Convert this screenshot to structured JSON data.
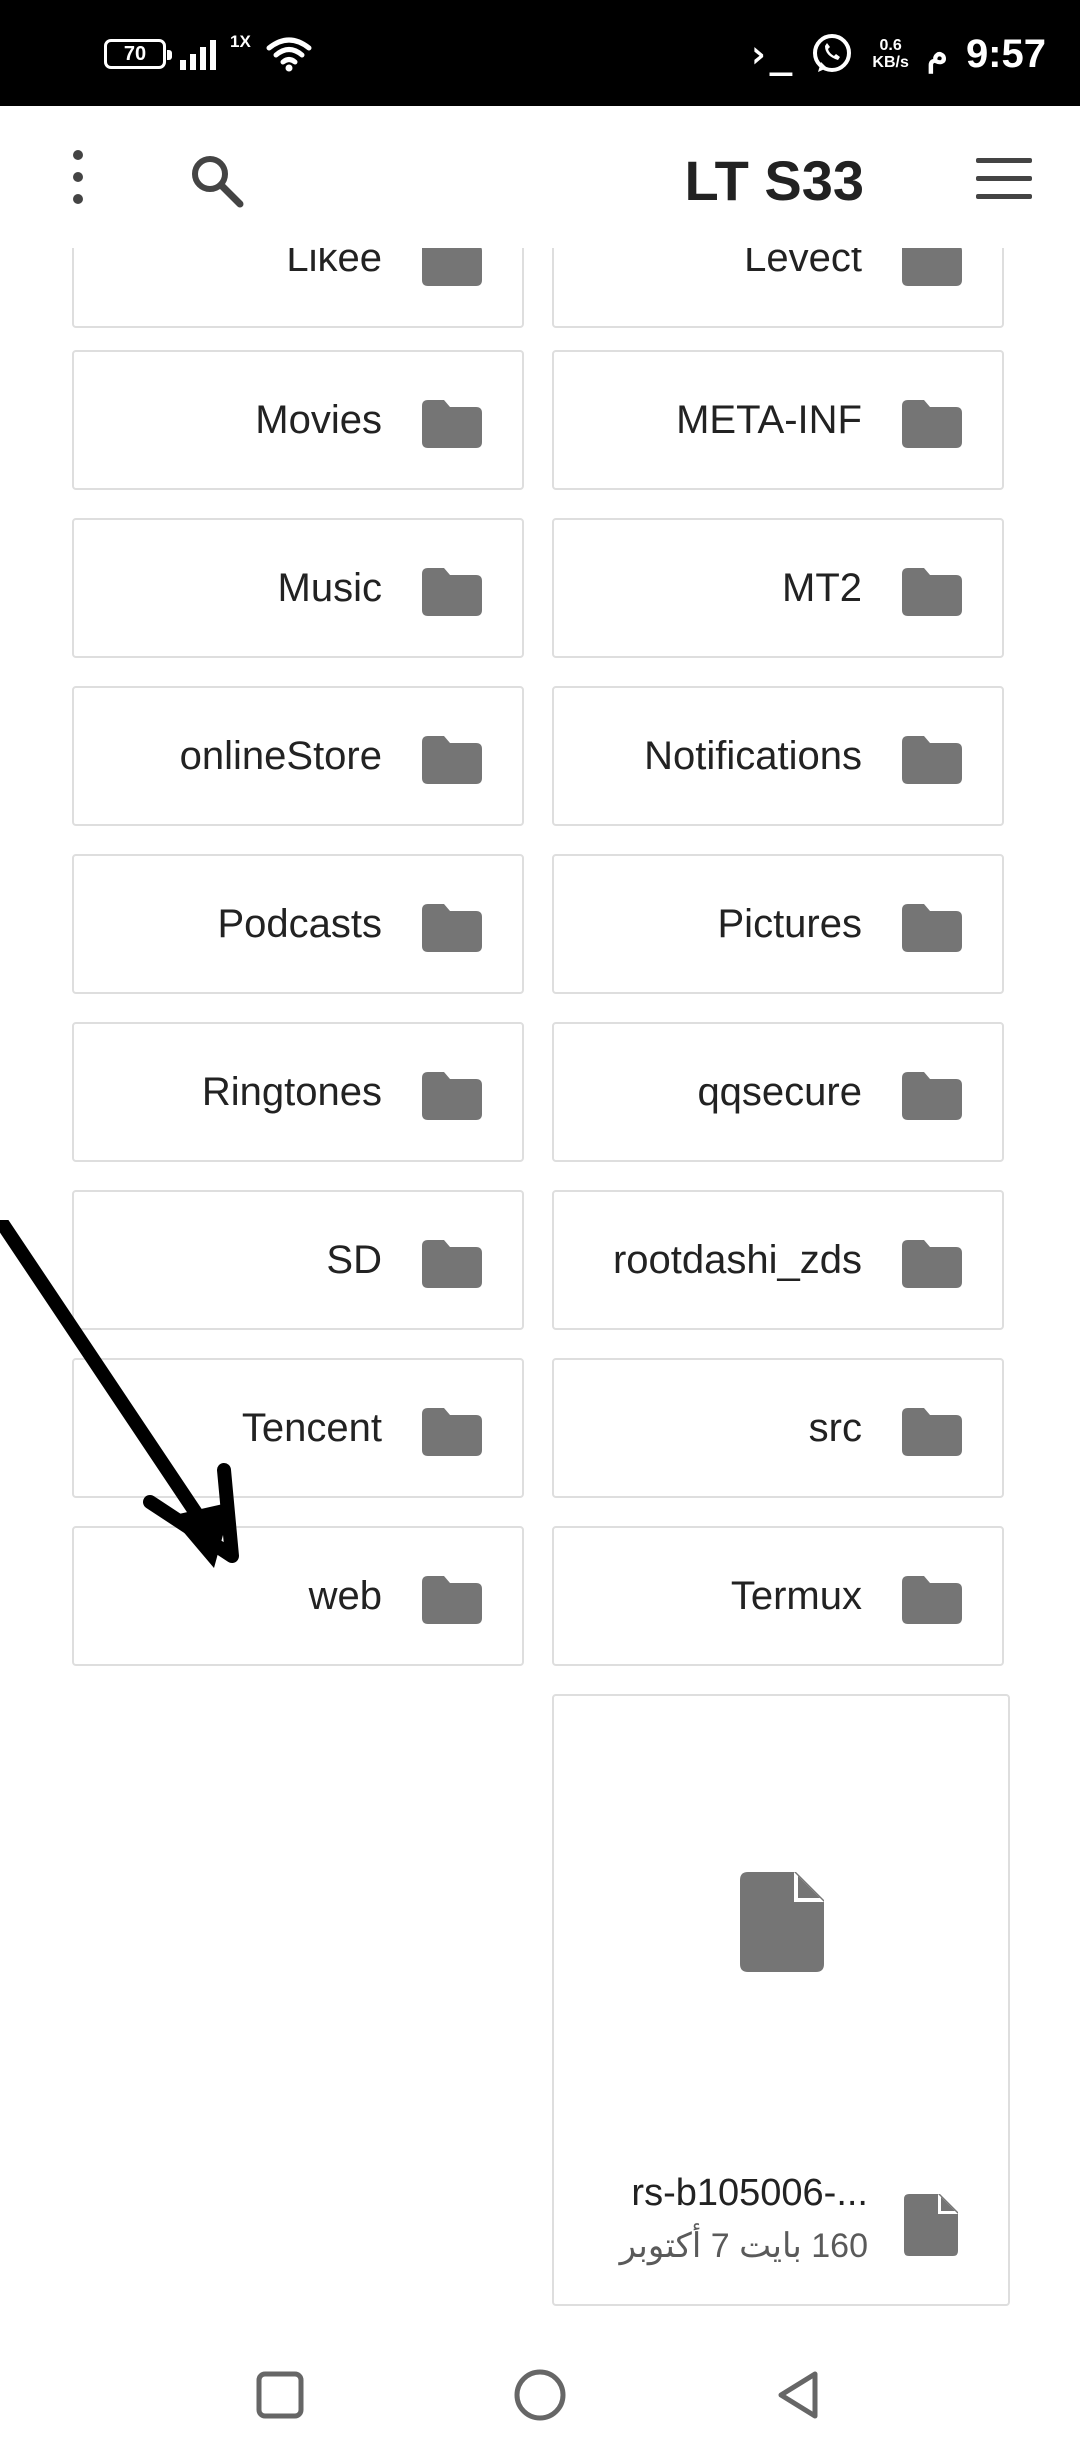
{
  "status_bar": {
    "battery": "70",
    "network_type": "1X",
    "speed_value": "0.6",
    "speed_unit": "KB/s",
    "time": "9:57",
    "meridiem": "م"
  },
  "app_bar": {
    "title": "LT S33"
  },
  "folders": {
    "row0": {
      "left": "Likee",
      "right": "Levect"
    },
    "row1": {
      "left": "Movies",
      "right": "META-INF"
    },
    "row2": {
      "left": "Music",
      "right": "MT2"
    },
    "row3": {
      "left": "onlineStore",
      "right": "Notifications"
    },
    "row4": {
      "left": "Podcasts",
      "right": "Pictures"
    },
    "row5": {
      "left": "Ringtones",
      "right": "qqsecure"
    },
    "row6": {
      "left": "SD",
      "right": "rootdashi_zds"
    },
    "row7": {
      "left": "Tencent",
      "right": "src"
    },
    "row8": {
      "left": "web",
      "right": "Termux"
    }
  },
  "file": {
    "name": "rs-b105006-...",
    "meta": "160 بايت 7 أكتوبر"
  },
  "colors": {
    "icon_gray": "#757575",
    "border": "#dedede",
    "status_bar_bg": "#000000"
  },
  "icons": {
    "folder": "folder-icon",
    "file": "file-icon",
    "search": "search-icon",
    "menu": "hamburger-menu-icon",
    "overflow": "more-vert-icon"
  }
}
